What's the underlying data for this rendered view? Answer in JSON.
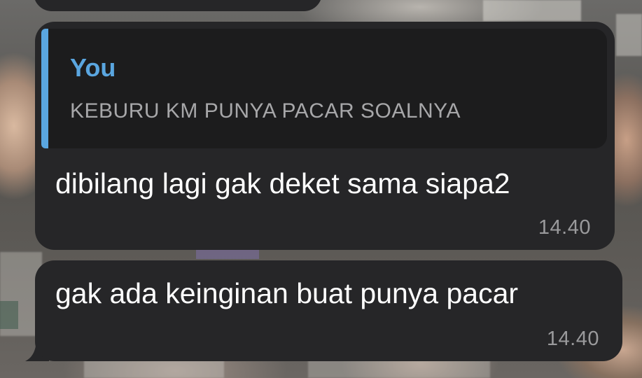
{
  "chat": {
    "messages": [
      {
        "reply": {
          "author": "You",
          "text": "KEBURU KM PUNYA PACAR SOALNYA"
        },
        "text": "dibilang lagi gak deket sama siapa2",
        "time": "14.40"
      },
      {
        "text": "gak ada keinginan buat punya pacar",
        "time": "14.40"
      }
    ]
  },
  "colors": {
    "bubble": "#262628",
    "reply_background": "#1c1c1d",
    "reply_accent": "#5aa6e0",
    "message_text": "#ffffff",
    "timestamp_text": "#9a9a9c"
  }
}
